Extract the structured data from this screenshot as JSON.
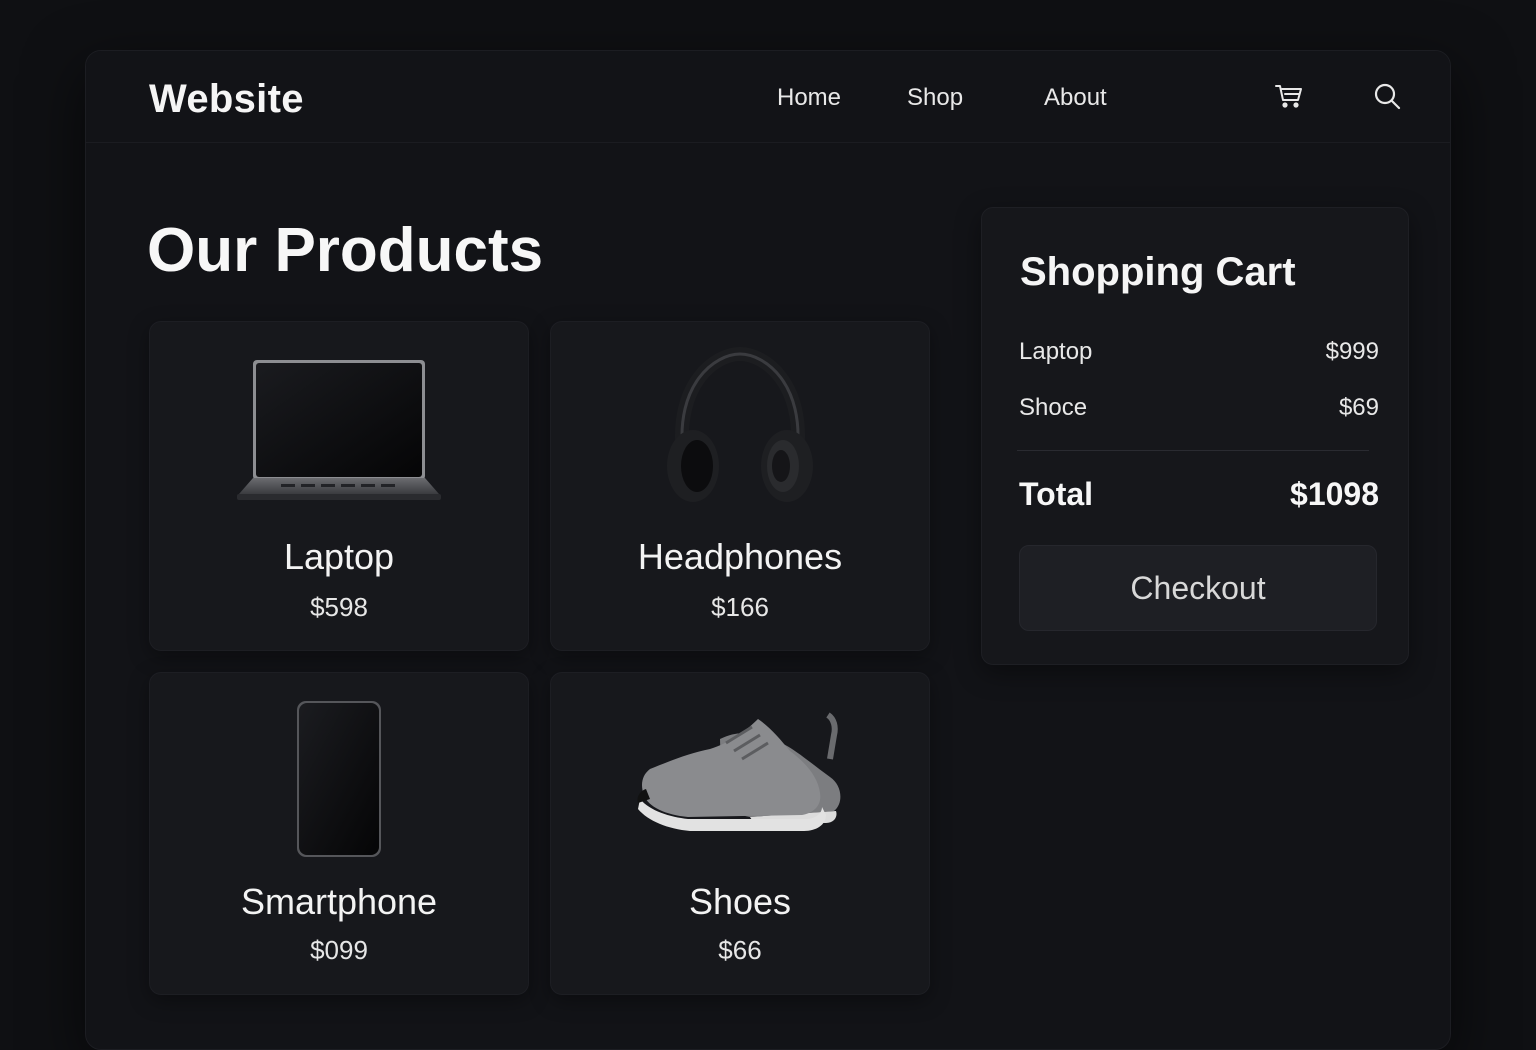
{
  "header": {
    "logo": "Website",
    "nav": [
      {
        "label": "Home"
      },
      {
        "label": "Shop"
      },
      {
        "label": "About"
      }
    ],
    "icons": [
      "cart-icon",
      "search-icon"
    ]
  },
  "main": {
    "title": "Our Products",
    "products": [
      {
        "name": "Laptop",
        "price": "$598",
        "image": "laptop-image"
      },
      {
        "name": "Headphones",
        "price": "$166",
        "image": "headphones-image"
      },
      {
        "name": "Smartphone",
        "price": "$099",
        "image": "smartphone-image"
      },
      {
        "name": "Shoes",
        "price": "$66",
        "image": "shoes-image"
      }
    ]
  },
  "cart": {
    "title": "Shopping Cart",
    "items": [
      {
        "name": "Laptop",
        "price": "$999"
      },
      {
        "name": "Shoce",
        "price": "$69"
      }
    ],
    "total_label": "Total",
    "total_value": "$1098",
    "checkout_label": "Checkout"
  },
  "colors": {
    "background": "#0f1013",
    "panel": "#121317",
    "card": "#17181c",
    "text": "#f2f2f2"
  }
}
